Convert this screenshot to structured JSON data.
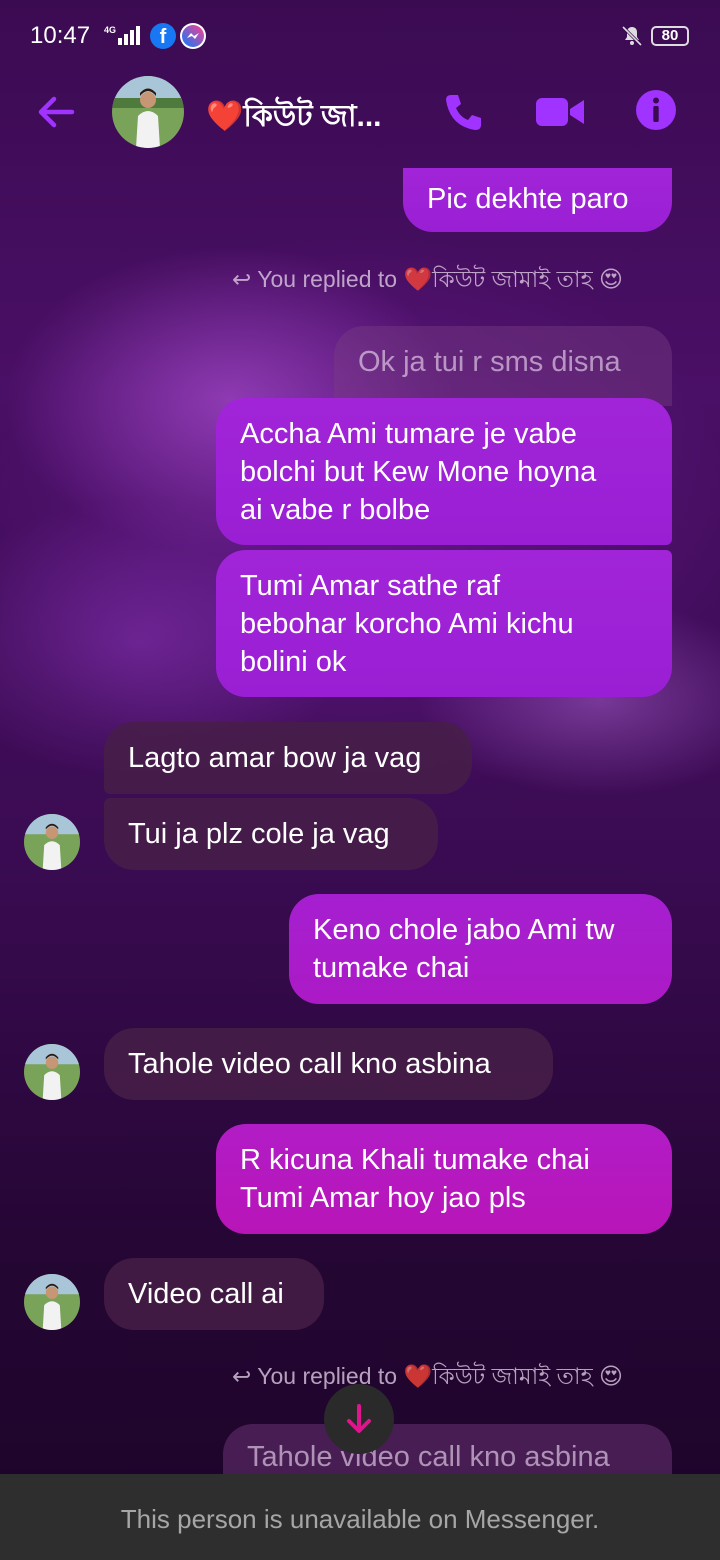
{
  "status_bar": {
    "time": "10:47",
    "network": "4G",
    "battery": "80"
  },
  "header": {
    "contact_name": "❤️কিউট জা...",
    "accent_color": "#a033ff"
  },
  "messages": [
    {
      "side": "out",
      "text": "Pic dekhte paro"
    },
    {
      "type": "reply_note",
      "text": "You replied to ❤️কিউট জামাই তাহ 😍"
    },
    {
      "side": "quoted",
      "text": "Ok ja tui r sms disna"
    },
    {
      "side": "out",
      "text": "Accha Ami tumare je vabe\nbolchi but Kew Mone hoyna\nai vabe r bolbe"
    },
    {
      "side": "out",
      "text": "Tumi Amar sathe raf\nbebohar korcho Ami kichu\nbolini ok"
    },
    {
      "side": "in",
      "text": "Lagto amar bow ja vag"
    },
    {
      "side": "in",
      "text": "Tui ja plz cole ja vag"
    },
    {
      "side": "out",
      "text": "Keno chole jabo Ami tw\ntumake chai"
    },
    {
      "side": "in",
      "text": "Tahole video call kno asbina"
    },
    {
      "side": "out",
      "text": "R kicuna Khali tumake chai\nTumi Amar hoy jao pls"
    },
    {
      "side": "in",
      "text": "Video call ai"
    },
    {
      "type": "reply_note",
      "text": "You replied to ❤️কিউট জামাই তাহ 😍"
    },
    {
      "side": "quoted",
      "text": "Tahole video call kno asbina"
    }
  ],
  "footer": {
    "notice": "This person is unavailable on Messenger."
  }
}
